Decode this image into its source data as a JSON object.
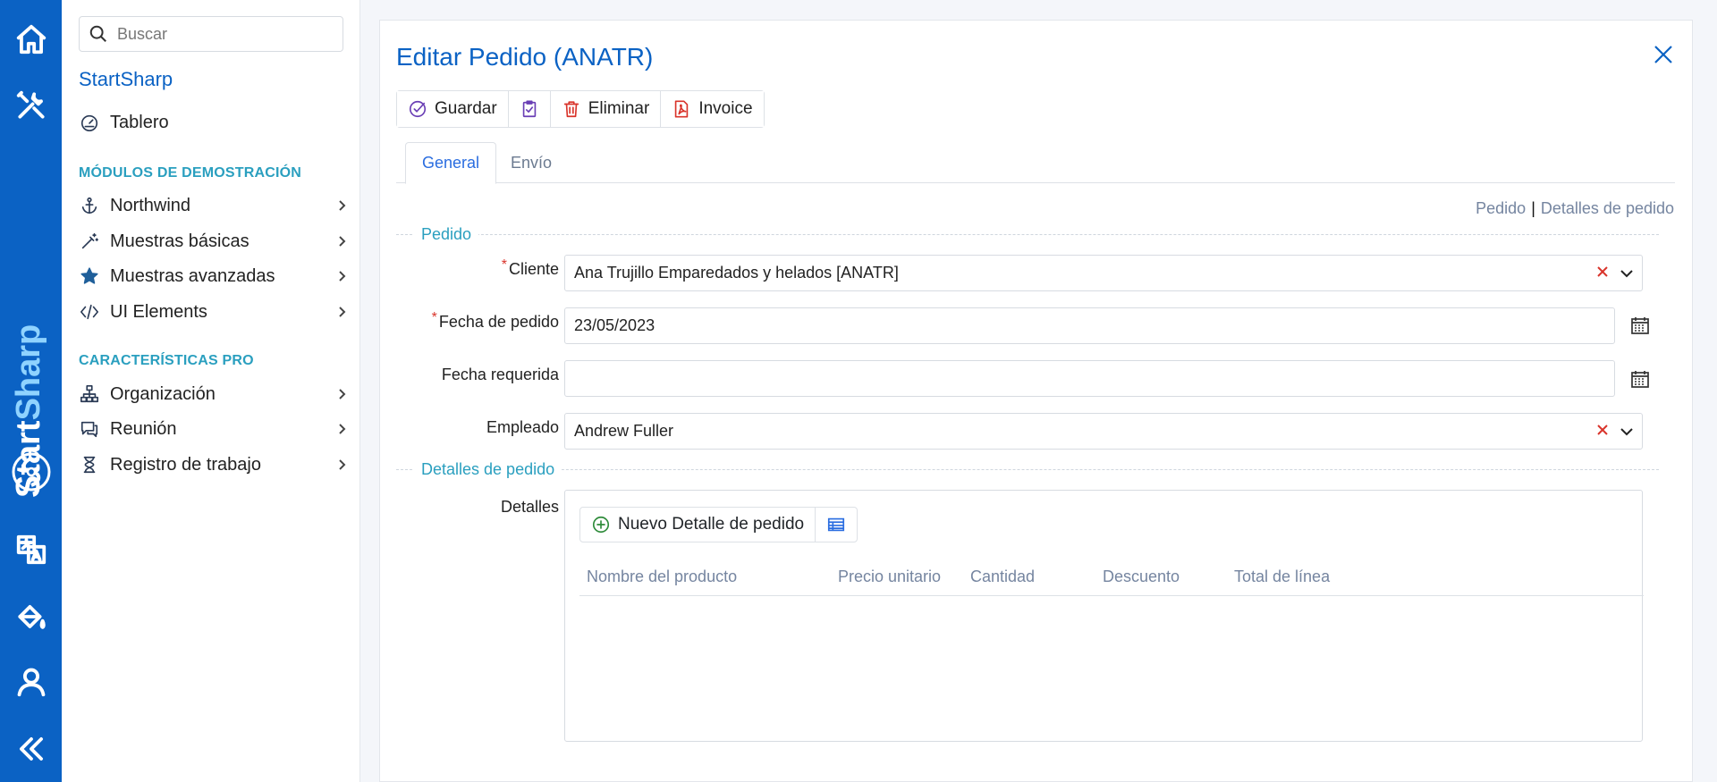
{
  "sidebar": {
    "search_placeholder": "Buscar",
    "brand": "StartSharp",
    "dashboard": "Tablero",
    "section_demo": "MÓDULOS DE DEMOSTRACIÓN",
    "demo_items": [
      "Northwind",
      "Muestras básicas",
      "Muestras avanzadas",
      "UI Elements"
    ],
    "section_pro": "CARACTERÍSTICAS PRO",
    "pro_items": [
      "Organización",
      "Reunión",
      "Registro de trabajo"
    ]
  },
  "rail": {
    "brand_start": "Start",
    "brand_sharp": "Sharp",
    "icons": [
      "home-icon",
      "tools-icon",
      "translate-icon",
      "paint-bucket-icon",
      "user-icon",
      "collapse-icon"
    ]
  },
  "dialog": {
    "title": "Editar Pedido (ANATR)",
    "toolbar": {
      "save": "Guardar",
      "delete": "Eliminar",
      "invoice": "Invoice"
    },
    "tabs": [
      "General",
      "Envío"
    ],
    "category_links": [
      "Pedido",
      "Detalles de pedido"
    ],
    "categories": {
      "order": "Pedido",
      "details": "Detalles de pedido"
    },
    "fields": {
      "customer_label": "Cliente",
      "customer_value": "Ana Trujillo Emparedados y helados [ANATR]",
      "order_date_label": "Fecha de pedido",
      "order_date_value": "23/05/2023",
      "required_date_label": "Fecha requerida",
      "required_date_value": "",
      "employee_label": "Empleado",
      "employee_value": "Andrew Fuller",
      "details_label": "Detalles"
    },
    "details_grid": {
      "new_button": "Nuevo Detalle de pedido",
      "columns": [
        "Nombre del producto",
        "Precio unitario",
        "Cantidad",
        "Descuento",
        "Total de línea"
      ]
    }
  },
  "colors": {
    "rail": "#0b62c4",
    "accent": "#0b62c4",
    "section": "#2a9fbf",
    "required": "#d9342b"
  }
}
